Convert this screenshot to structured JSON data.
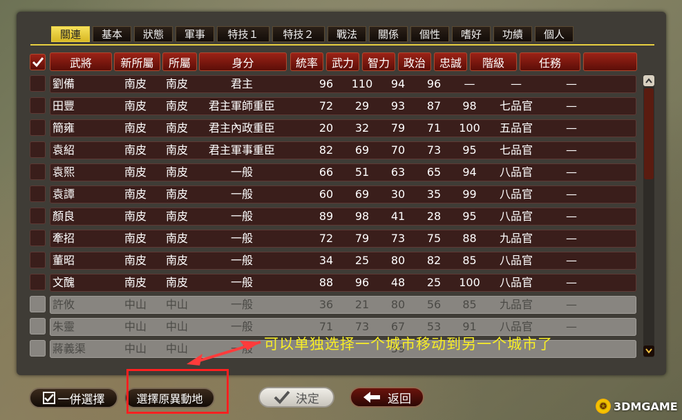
{
  "tabs": [
    {
      "label": "關連",
      "active": true
    },
    {
      "label": "基本",
      "active": false
    },
    {
      "label": "狀態",
      "active": false
    },
    {
      "label": "軍事",
      "active": false
    },
    {
      "label": "特技１",
      "active": false
    },
    {
      "label": "特技２",
      "active": false
    },
    {
      "label": "戰法",
      "active": false
    },
    {
      "label": "關係",
      "active": false
    },
    {
      "label": "個性",
      "active": false
    },
    {
      "label": "嗜好",
      "active": false
    },
    {
      "label": "功績",
      "active": false
    },
    {
      "label": "個人",
      "active": false
    }
  ],
  "columns": [
    "武將",
    "新所屬",
    "所屬",
    "身分",
    "統率",
    "武力",
    "智力",
    "政治",
    "忠誠",
    "階級",
    "任務",
    ""
  ],
  "rows": [
    {
      "cells": [
        "劉備",
        "南皮",
        "南皮",
        "君主",
        "96",
        "110",
        "94",
        "96",
        "—",
        "—",
        "—"
      ],
      "disabled": false
    },
    {
      "cells": [
        "田豐",
        "南皮",
        "南皮",
        "君主軍師重臣",
        "72",
        "29",
        "93",
        "87",
        "98",
        "七品官",
        "—"
      ],
      "disabled": false
    },
    {
      "cells": [
        "簡雍",
        "南皮",
        "南皮",
        "君主內政重臣",
        "20",
        "32",
        "79",
        "71",
        "100",
        "五品官",
        "—"
      ],
      "disabled": false
    },
    {
      "cells": [
        "袁紹",
        "南皮",
        "南皮",
        "君主軍事重臣",
        "82",
        "69",
        "70",
        "73",
        "95",
        "七品官",
        "—"
      ],
      "disabled": false
    },
    {
      "cells": [
        "袁熙",
        "南皮",
        "南皮",
        "一般",
        "66",
        "51",
        "63",
        "65",
        "94",
        "八品官",
        "—"
      ],
      "disabled": false
    },
    {
      "cells": [
        "袁譚",
        "南皮",
        "南皮",
        "一般",
        "60",
        "69",
        "30",
        "35",
        "99",
        "八品官",
        "—"
      ],
      "disabled": false
    },
    {
      "cells": [
        "顏良",
        "南皮",
        "南皮",
        "一般",
        "89",
        "98",
        "41",
        "28",
        "95",
        "八品官",
        "—"
      ],
      "disabled": false
    },
    {
      "cells": [
        "牽招",
        "南皮",
        "南皮",
        "一般",
        "72",
        "79",
        "73",
        "75",
        "88",
        "九品官",
        "—"
      ],
      "disabled": false
    },
    {
      "cells": [
        "董昭",
        "南皮",
        "南皮",
        "一般",
        "34",
        "25",
        "80",
        "82",
        "85",
        "八品官",
        "—"
      ],
      "disabled": false
    },
    {
      "cells": [
        "文醜",
        "南皮",
        "南皮",
        "一般",
        "88",
        "96",
        "48",
        "25",
        "100",
        "八品官",
        "—"
      ],
      "disabled": false
    },
    {
      "cells": [
        "許攸",
        "中山",
        "中山",
        "一般",
        "36",
        "21",
        "80",
        "56",
        "85",
        "九品官",
        "—"
      ],
      "disabled": true
    },
    {
      "cells": [
        "朱靈",
        "中山",
        "中山",
        "一般",
        "71",
        "73",
        "67",
        "53",
        "91",
        "八品官",
        "—"
      ],
      "disabled": true
    },
    {
      "cells": [
        "蔣義渠",
        "中山",
        "中山",
        "一般",
        "",
        "",
        "59",
        "",
        "",
        "",
        ""
      ],
      "disabled": true
    }
  ],
  "buttons": {
    "select_all": "一併選擇",
    "select_original": "選擇原異動地",
    "confirm": "決定",
    "back": "返回"
  },
  "annotation": "可以单独选择一个城市移动到另一个城市了",
  "watermark": "3DMGAME",
  "colors": {
    "accent_tab": "#e8d040",
    "header_red": "#9c2216",
    "row_dark": "#3a1e1b",
    "row_disabled": "#888580",
    "annotation": "#f8ee26",
    "highlight": "#ff2020"
  }
}
